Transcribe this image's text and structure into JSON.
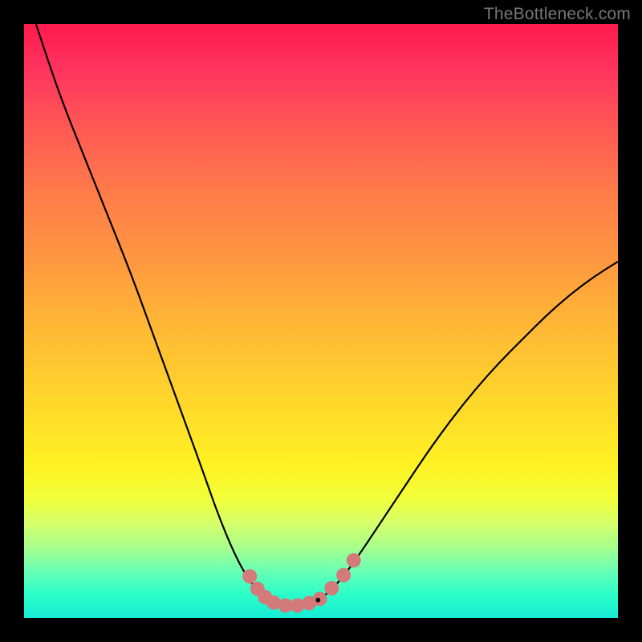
{
  "watermark": "TheBottleneck.com",
  "chart_data": {
    "type": "line",
    "title": "",
    "xlabel": "",
    "ylabel": "",
    "xlim": [
      0,
      100
    ],
    "ylim": [
      0,
      100
    ],
    "series": [
      {
        "name": "left-curve",
        "x": [
          2,
          6,
          10,
          14,
          18,
          22,
          26,
          30,
          33,
          36,
          38.5,
          40.5,
          42
        ],
        "values": [
          100,
          88,
          78,
          68,
          58,
          47,
          36,
          25,
          16.5,
          9.5,
          5.5,
          3.2,
          2.4
        ]
      },
      {
        "name": "valley-floor",
        "x": [
          42,
          44,
          46,
          48,
          50
        ],
        "values": [
          2.4,
          2.1,
          2.1,
          2.4,
          3.2
        ]
      },
      {
        "name": "right-curve",
        "x": [
          50,
          53,
          56,
          60,
          64,
          68,
          72,
          76,
          80,
          84,
          88,
          92,
          96,
          100
        ],
        "values": [
          3.2,
          6,
          10,
          16,
          22,
          28,
          33.5,
          38.5,
          43,
          47,
          51,
          54.5,
          57.5,
          60
        ]
      }
    ],
    "markers": [
      {
        "name": "marker-left-top",
        "x": 38.0,
        "y": 7.0
      },
      {
        "name": "marker-left-2",
        "x": 39.3,
        "y": 4.9
      },
      {
        "name": "marker-left-3",
        "x": 40.6,
        "y": 3.5
      },
      {
        "name": "marker-bottom-left",
        "x": 42.0,
        "y": 2.6
      },
      {
        "name": "marker-bottom-2",
        "x": 44.0,
        "y": 2.1
      },
      {
        "name": "marker-bottom-3",
        "x": 46.0,
        "y": 2.1
      },
      {
        "name": "marker-bottom-right",
        "x": 48.0,
        "y": 2.5
      },
      {
        "name": "marker-right-1",
        "x": 49.8,
        "y": 3.2
      },
      {
        "name": "marker-right-2",
        "x": 51.8,
        "y": 5.0
      },
      {
        "name": "marker-right-3",
        "x": 53.8,
        "y": 7.2
      },
      {
        "name": "marker-right-top",
        "x": 55.5,
        "y": 9.7
      }
    ],
    "dark_point": {
      "x": 49.5,
      "y": 3.0
    },
    "marker_color": "#d47a7a",
    "curve_color": "#000000"
  }
}
